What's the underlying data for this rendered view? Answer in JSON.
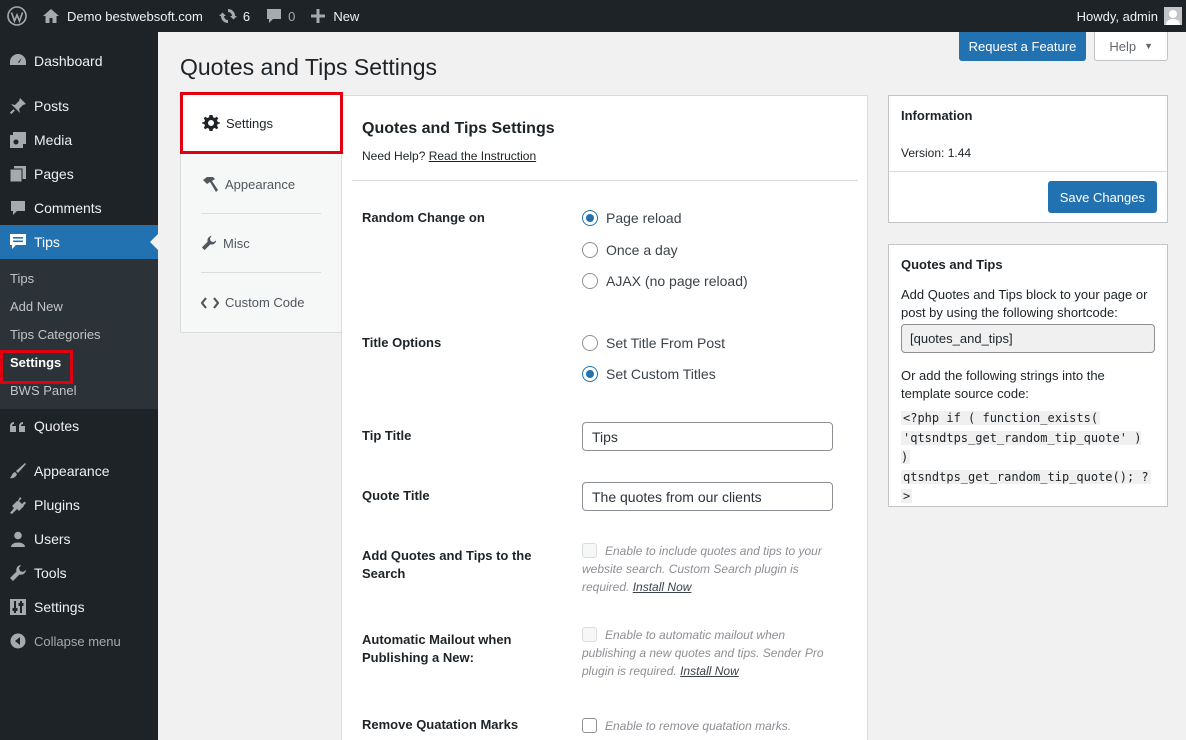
{
  "adminbar": {
    "site_name": "Demo bestwebsoft.com",
    "updates_count": "6",
    "comments_count": "0",
    "new_label": "New",
    "greeting": "Howdy, admin"
  },
  "sidebar": {
    "items": [
      {
        "label": "Dashboard",
        "icon": "dashboard-icon"
      },
      {
        "label": "Posts",
        "icon": "pin-icon"
      },
      {
        "label": "Media",
        "icon": "media-icon"
      },
      {
        "label": "Pages",
        "icon": "pages-icon"
      },
      {
        "label": "Comments",
        "icon": "comment-icon"
      },
      {
        "label": "Tips",
        "icon": "tips-icon"
      },
      {
        "label": "Quotes",
        "icon": "quote-icon"
      },
      {
        "label": "Appearance",
        "icon": "brush-icon"
      },
      {
        "label": "Plugins",
        "icon": "plug-icon"
      },
      {
        "label": "Users",
        "icon": "user-icon"
      },
      {
        "label": "Tools",
        "icon": "wrench-icon"
      },
      {
        "label": "Settings",
        "icon": "sliders-icon"
      }
    ],
    "submenu": [
      "Tips",
      "Add New",
      "Tips Categories",
      "Settings",
      "BWS Panel"
    ],
    "collapse_label": "Collapse menu"
  },
  "header": {
    "page_title": "Quotes and Tips Settings",
    "request_feature": "Request a Feature",
    "help": "Help"
  },
  "tabs": [
    "Settings",
    "Appearance",
    "Misc",
    "Custom Code"
  ],
  "main": {
    "title": "Quotes and Tips Settings",
    "need_help": "Need Help?",
    "instruction_link": "Read the Instruction",
    "random_change_label": "Random Change on",
    "random_options": [
      "Page reload",
      "Once a day",
      "AJAX (no page reload)"
    ],
    "random_selected": "Page reload",
    "title_options_label": "Title Options",
    "title_options": [
      "Set Title From Post",
      "Set Custom Titles"
    ],
    "title_selected": "Set Custom Titles",
    "tip_title_label": "Tip Title",
    "tip_title_value": "Tips",
    "quote_title_label": "Quote Title",
    "quote_title_value": "The quotes from our clients",
    "search_label": "Add Quotes and Tips to the Search",
    "search_desc": "Enable to include quotes and tips to your website search. Custom Search plugin is required.",
    "search_link": "Install Now",
    "mailout_label": "Automatic Mailout when Publishing a New:",
    "mailout_desc": "Enable to automatic mailout when publishing a new quotes and tips. Sender Pro plugin is required.",
    "mailout_link": "Install Now",
    "quotation_label": "Remove Quatation Marks",
    "quotation_desc": "Enable to remove quatation marks."
  },
  "info_box": {
    "title": "Information",
    "version": "Version: 1.44",
    "save_button": "Save Changes"
  },
  "qt_box": {
    "title": "Quotes and Tips",
    "desc1": "Add Quotes and Tips block to your page or post by using the following shortcode:",
    "shortcode": "[quotes_and_tips]",
    "desc2": "Or add the following strings into the template source code:",
    "code_lines": [
      "<?php if ( function_exists(",
      "'qtsndtps_get_random_tip_quote' ) )",
      "qtsndtps_get_random_tip_quote(); ?",
      ">"
    ]
  },
  "colors": {
    "accent": "#2271b1",
    "highlight_border": "#e0000f",
    "adminbar_bg": "#1d2327"
  }
}
